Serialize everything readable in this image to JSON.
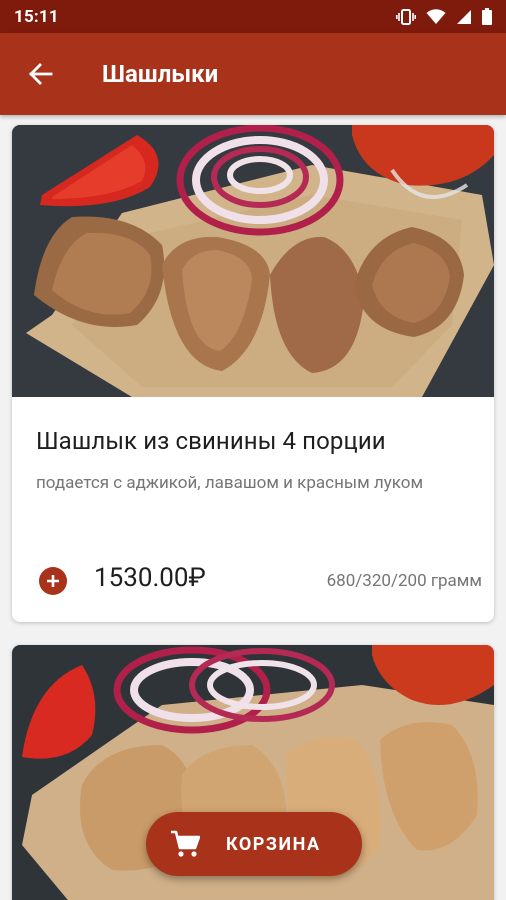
{
  "status_bar": {
    "time": "15:11"
  },
  "app_bar": {
    "title": "Шашлыки"
  },
  "products": [
    {
      "title": "Шашлык из свинины 4 порции",
      "description": "подается с аджикой, лавашом и красным луком",
      "price": "1530.00₽",
      "weight": "680/320/200 грамм"
    }
  ],
  "cart": {
    "label": "КОРЗИНА"
  },
  "colors": {
    "status_bar": "#7f1b0c",
    "accent": "#a8321a"
  }
}
